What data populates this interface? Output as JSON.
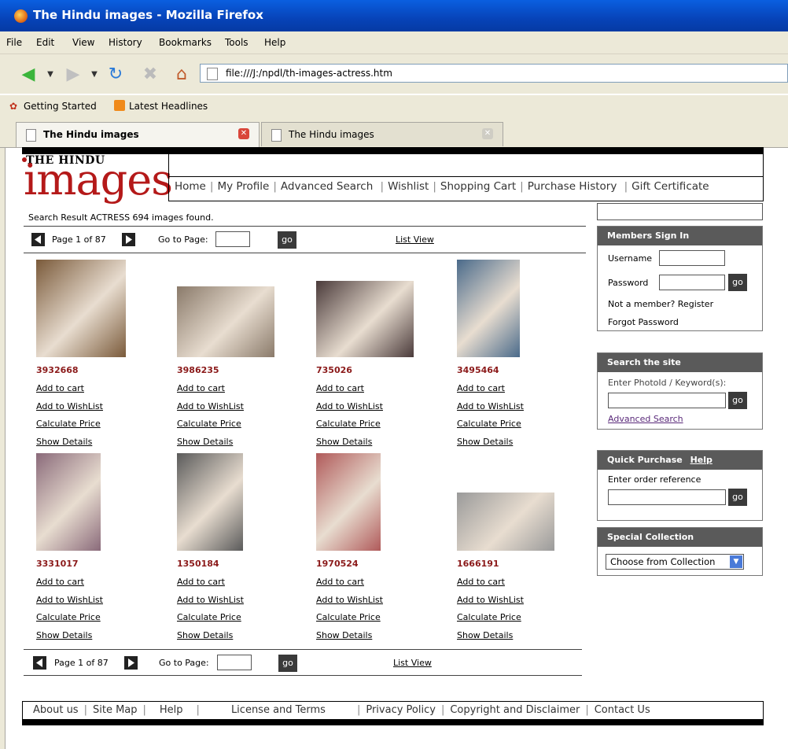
{
  "window": {
    "title": "The Hindu images - Mozilla Firefox"
  },
  "menu": [
    "File",
    "Edit",
    "View",
    "History",
    "Bookmarks",
    "Tools",
    "Help"
  ],
  "address": {
    "url": "file:///J:/npdl/th-images-actress.htm"
  },
  "bookmarks": [
    "Getting Started",
    "Latest Headlines"
  ],
  "tabs": [
    {
      "label": "The Hindu images"
    },
    {
      "label": "The Hindu images"
    }
  ],
  "logo": {
    "line1": "THE HINDU",
    "line2": "images"
  },
  "nav": [
    "Home",
    "My Profile",
    "Advanced Search",
    "Wishlist",
    "Shopping Cart",
    "Purchase History",
    "Gift Certificate"
  ],
  "result": {
    "text": "Search Result  ACTRESS  694 images found."
  },
  "pager_top": {
    "page": "Page 1 of 87",
    "goto": "Go to Page:",
    "go": "go",
    "view": "List View"
  },
  "pager_bottom": {
    "page": "Page 1 of 87",
    "goto": "Go to Page:",
    "go": "go",
    "view": "List View"
  },
  "links": {
    "cart": "Add to cart",
    "wish": "Add to WishList",
    "price": "Calculate Price",
    "details": "Show Details"
  },
  "results": [
    {
      "id": "3932668",
      "color": "#7a5a3a"
    },
    {
      "id": "3986235",
      "color": "#8a7a6a"
    },
    {
      "id": "735026",
      "color": "#4a3a3a"
    },
    {
      "id": "3495464",
      "color": "#4a6a8a"
    },
    {
      "id": "3331017",
      "color": "#8a6a7a"
    },
    {
      "id": "1350184",
      "color": "#5a5a5a"
    },
    {
      "id": "1970524",
      "color": "#b05a5a"
    },
    {
      "id": "1666191",
      "color": "#9a9a9a"
    }
  ],
  "members": {
    "title": "Members Sign In",
    "username": "Username",
    "password": "Password",
    "go": "go",
    "not_member": "Not a member? Register",
    "forgot": "Forgot Password"
  },
  "search_site": {
    "title": "Search the site",
    "label": "Enter PhotoId / Keyword(s):",
    "go": "go",
    "advanced": "Advanced Search"
  },
  "quick": {
    "title": "Quick Purchase",
    "help": "Help",
    "label": "Enter order reference",
    "go": "go"
  },
  "special": {
    "title": "Special Collection",
    "select": "Choose from Collection"
  },
  "footer": [
    "About us",
    "Site Map",
    "Help",
    "License and Terms",
    "Privacy Policy",
    "Copyright and Disclaimer",
    "Contact Us"
  ]
}
